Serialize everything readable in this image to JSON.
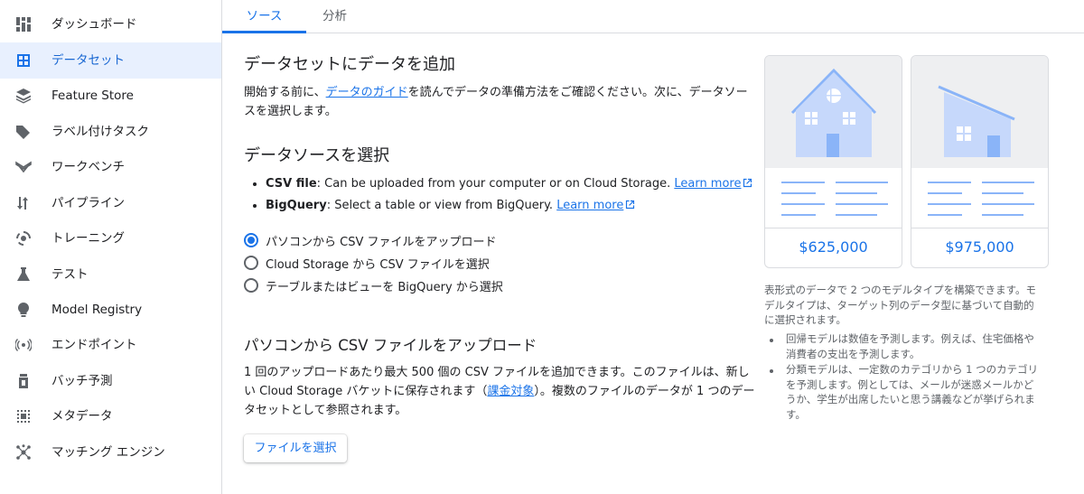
{
  "sidebar": {
    "items": [
      {
        "label": "ダッシュボード",
        "icon": "dashboard-icon"
      },
      {
        "label": "データセット",
        "icon": "dataset-icon",
        "active": true
      },
      {
        "label": "Feature Store",
        "icon": "feature-store-icon"
      },
      {
        "label": "ラベル付けタスク",
        "icon": "label-tag-icon"
      },
      {
        "label": "ワークベンチ",
        "icon": "workbench-icon"
      },
      {
        "label": "パイプライン",
        "icon": "pipeline-icon"
      },
      {
        "label": "トレーニング",
        "icon": "training-icon"
      },
      {
        "label": "テスト",
        "icon": "flask-icon"
      },
      {
        "label": "Model Registry",
        "icon": "lightbulb-icon"
      },
      {
        "label": "エンドポイント",
        "icon": "endpoint-icon"
      },
      {
        "label": "バッチ予測",
        "icon": "batch-predict-icon"
      },
      {
        "label": "メタデータ",
        "icon": "metadata-icon"
      },
      {
        "label": "マッチング エンジン",
        "icon": "matching-engine-icon"
      }
    ]
  },
  "tabs": [
    {
      "label": "ソース",
      "active": true
    },
    {
      "label": "分析",
      "active": false
    }
  ],
  "main": {
    "title": "データセットにデータを追加",
    "intro": {
      "before": "開始する前に、",
      "link": "データのガイド",
      "after_line1": "を読んでデータの準備方法をご確認ください。次に、データソー",
      "line2": "スを選択します。"
    },
    "source_heading": "データソースを選択",
    "bullets": [
      {
        "bold": "CSV file",
        "text": ": Can be uploaded from your computer or on Cloud Storage. ",
        "link": "Learn more"
      },
      {
        "bold": "BigQuery",
        "text": ": Select a table or view from BigQuery. ",
        "link": "Learn more"
      }
    ],
    "radios": [
      {
        "label": "パソコンから CSV ファイルをアップロード",
        "checked": true
      },
      {
        "label": "Cloud Storage から CSV ファイルを選択",
        "checked": false
      },
      {
        "label": "テーブルまたはビューを BigQuery から選択",
        "checked": false
      }
    ],
    "upload_heading": "パソコンから CSV ファイルをアップロード",
    "upload_desc": {
      "line1": "1 回のアップロードあたり最大 500 個の CSV ファイルを追加できます。このファイルは、新し",
      "line2_before": "い Cloud Storage バケットに保存されます（",
      "line2_link": "課金対象",
      "line2_after": "）。複数のファイルのデータが 1 つのデー",
      "line3": "タセットとして参照されます。"
    },
    "select_file_button": "ファイルを選択"
  },
  "side_panel": {
    "cards": [
      {
        "price": "$625,000"
      },
      {
        "price": "$975,000"
      }
    ],
    "description_lines": [
      "表形式のデータで 2 つのモデルタイプを構築できます。モ",
      "デルタイプは、ターゲット列のデータ型に基づいて自動的",
      "に選択されます。"
    ],
    "bullets": [
      [
        "回帰モデルは数値を予測します。例えば、住宅価格や",
        "消費者の支出を予測します。"
      ],
      [
        "分類モデルは、一定数のカテゴリから 1 つのカテゴリ",
        "を予測します。例としては、メールが迷惑メールかど",
        "うか、学生が出席したいと思う講義などが挙げられま",
        "す。"
      ]
    ]
  },
  "colors": {
    "accent": "#1a73e8",
    "active_bg": "#e8f0fe",
    "illustration_fill": "#c6d8fb",
    "illustration_stroke": "#8ab4f8"
  }
}
